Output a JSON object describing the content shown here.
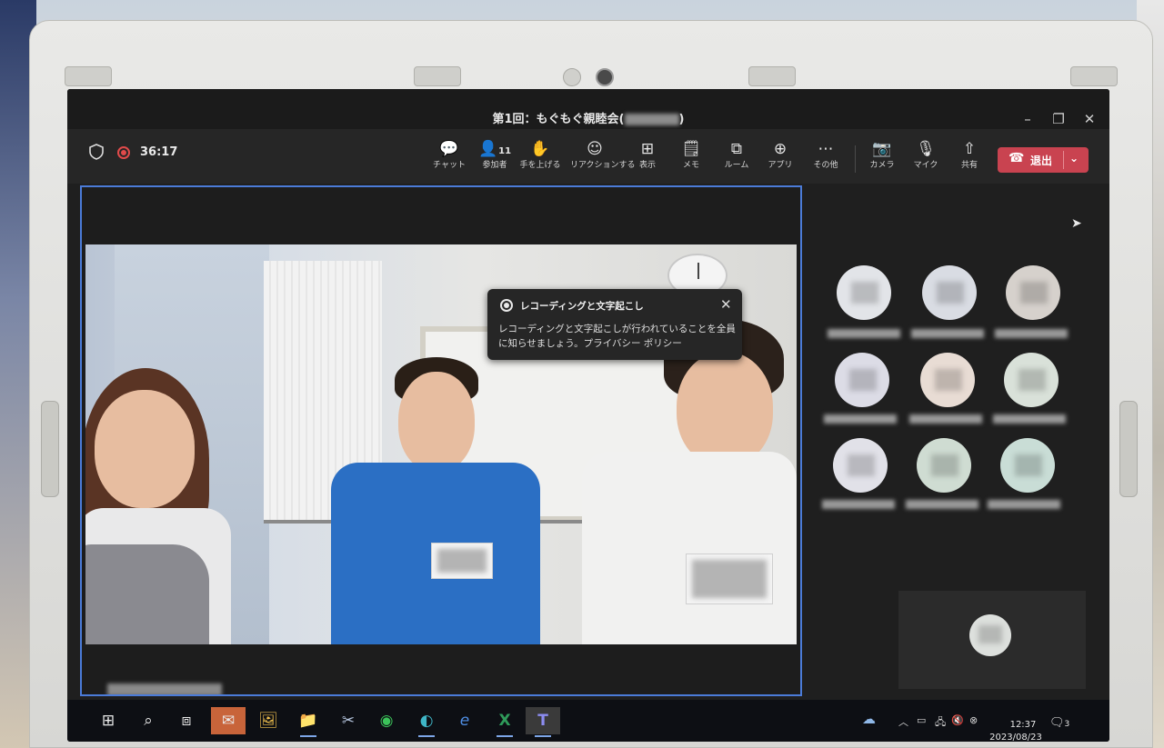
{
  "window": {
    "title_prefix": "第1回：もぐもぐ親睦会(",
    "title_suffix": ")",
    "minimize": "–",
    "maximize": "❐",
    "close": "✕"
  },
  "toolbar": {
    "timer": "36:17",
    "participant_count": "11",
    "items": [
      {
        "icon": "chat-icon",
        "glyph": "💬",
        "label": "チャット"
      },
      {
        "icon": "people-icon",
        "glyph": "👤",
        "label": "参加者"
      },
      {
        "icon": "raise-hand-icon",
        "glyph": "✋",
        "label": "手を上げる"
      },
      {
        "icon": "reaction-icon",
        "glyph": "☺",
        "label": "リアクションする"
      },
      {
        "icon": "view-icon",
        "glyph": "⊞",
        "label": "表示"
      },
      {
        "icon": "notes-icon",
        "glyph": "🗒",
        "label": "メモ"
      },
      {
        "icon": "rooms-icon",
        "glyph": "⧉",
        "label": "ルーム"
      },
      {
        "icon": "apps-icon",
        "glyph": "⊕",
        "label": "アプリ"
      },
      {
        "icon": "more-icon",
        "glyph": "⋯",
        "label": "その他"
      },
      {
        "icon": "camera-icon",
        "glyph": "📷",
        "label": "カメラ"
      },
      {
        "icon": "mic-off-icon",
        "glyph": "🎙",
        "label": "マイク"
      },
      {
        "icon": "share-icon",
        "glyph": "⇧",
        "label": "共有"
      }
    ],
    "leave_label": "退出"
  },
  "notice": {
    "title": "レコーディングと文字起こし",
    "message": "レコーディングと文字起こしが行われていることを全員に知らせましょう。プライバシー ポリシー"
  },
  "participants": {
    "avatar_colors": [
      "#e2e4e8",
      "#d9dce3",
      "#d6d1cc",
      "#dcdce6",
      "#e8dcd4",
      "#d9e1d9",
      "#e1e1e8",
      "#cfdcd2",
      "#c9ddd6"
    ]
  },
  "taskbar": {
    "icons": [
      {
        "icon": "windows-start-icon",
        "glyph": "⊞"
      },
      {
        "icon": "search-icon",
        "glyph": "⌕"
      },
      {
        "icon": "task-view-icon",
        "glyph": "⧈"
      },
      {
        "icon": "outlook-icon",
        "glyph": "✉"
      },
      {
        "icon": "photos-icon",
        "glyph": "🖼"
      },
      {
        "icon": "file-explorer-icon",
        "glyph": "📁"
      },
      {
        "icon": "snipping-tool-icon",
        "glyph": "✂"
      },
      {
        "icon": "line-app-icon",
        "glyph": "◉"
      },
      {
        "icon": "edge-icon",
        "glyph": "◐"
      },
      {
        "icon": "internet-explorer-icon",
        "glyph": "e"
      },
      {
        "icon": "excel-icon",
        "glyph": "X"
      },
      {
        "icon": "teams-icon",
        "glyph": "T"
      }
    ],
    "time": "12:37",
    "date": "2023/08/23",
    "notification_count": "3"
  }
}
